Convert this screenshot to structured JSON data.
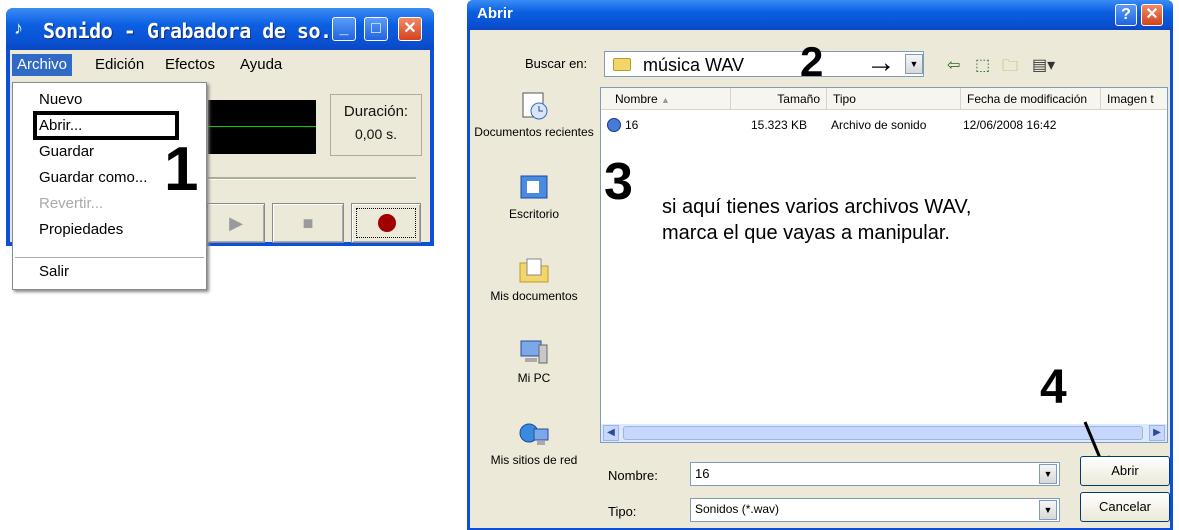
{
  "recorder": {
    "title": "Sonido - Grabadora de so...",
    "menubar": [
      "Archivo",
      "Edición",
      "Efectos",
      "Ayuda"
    ],
    "file_menu": [
      "Nuevo",
      "Abrir...",
      "Guardar",
      "Guardar como...",
      "Revertir...",
      "Propiedades",
      "Salir"
    ],
    "duration_label": "Duración:",
    "duration_value": "0,00 s."
  },
  "dialog": {
    "title": "Abrir",
    "look_in_label": "Buscar en:",
    "look_in_value": "música WAV",
    "places": [
      "Documentos recientes",
      "Escritorio",
      "Mis documentos",
      "Mi PC",
      "Mis sitios de red"
    ],
    "columns": [
      "Nombre",
      "Tamaño",
      "Tipo",
      "Fecha de modificación",
      "Imagen t"
    ],
    "file": {
      "name": "16",
      "size": "15.323 KB",
      "type": "Archivo de sonido",
      "date": "12/06/2008 16:42"
    },
    "instruction_line1": "si aquí tienes varios archivos WAV,",
    "instruction_line2": "marca el que vayas a manipular.",
    "filename_label": "Nombre:",
    "filename_value": "16",
    "filetype_label": "Tipo:",
    "filetype_value": "Sonidos (*.wav)",
    "open_button": "Abrir",
    "cancel_button": "Cancelar"
  },
  "annotations": {
    "n1": "1",
    "n2": "2",
    "n3": "3",
    "n4": "4"
  }
}
